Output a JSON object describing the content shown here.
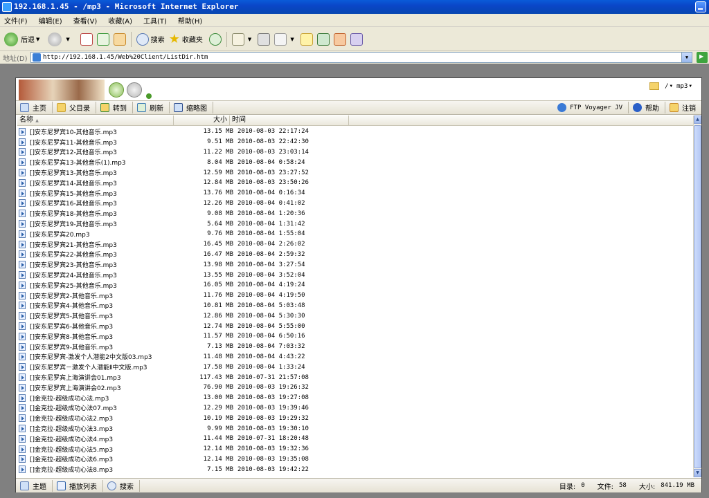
{
  "window": {
    "title": "192.168.1.45 - /mp3 - Microsoft Internet Explorer"
  },
  "menu": [
    "文件(F)",
    "编辑(E)",
    "查看(V)",
    "收藏(A)",
    "工具(T)",
    "帮助(H)"
  ],
  "toolbar": {
    "back_label": "后退",
    "search_label": "搜索",
    "favorites_label": "收藏夹"
  },
  "address": {
    "label": "地址(D)",
    "url": "http://192.168.1.45/Web%20Client/ListDir.htm"
  },
  "path": {
    "root": "/",
    "current": "mp3"
  },
  "nav": {
    "home": "主页",
    "parent": "父目录",
    "goto": "转到",
    "refresh": "刷新",
    "thumbnails": "缩略图",
    "product": "FTP Voyager JV",
    "help": "帮助",
    "logout": "注销"
  },
  "columns": {
    "name": "名称",
    "size": "大小",
    "time": "时间"
  },
  "files": [
    {
      "name": "[]安东尼罗宾10-其他音乐.mp3",
      "size": "13.15 MB",
      "time": "2010-08-03 22:17:24"
    },
    {
      "name": "[]安东尼罗宾11-其他音乐.mp3",
      "size": "9.51 MB",
      "time": "2010-08-03 22:42:30"
    },
    {
      "name": "[]安东尼罗宾12-其他音乐.mp3",
      "size": "11.22 MB",
      "time": "2010-08-03 23:03:14"
    },
    {
      "name": "[]安东尼罗宾13-其他音乐(1).mp3",
      "size": "8.04 MB",
      "time": "2010-08-04 0:58:24"
    },
    {
      "name": "[]安东尼罗宾13-其他音乐.mp3",
      "size": "12.59 MB",
      "time": "2010-08-03 23:27:52"
    },
    {
      "name": "[]安东尼罗宾14-其他音乐.mp3",
      "size": "12.84 MB",
      "time": "2010-08-03 23:50:26"
    },
    {
      "name": "[]安东尼罗宾15-其他音乐.mp3",
      "size": "13.76 MB",
      "time": "2010-08-04 0:16:34"
    },
    {
      "name": "[]安东尼罗宾16-其他音乐.mp3",
      "size": "12.26 MB",
      "time": "2010-08-04 0:41:02"
    },
    {
      "name": "[]安东尼罗宾18-其他音乐.mp3",
      "size": "9.08 MB",
      "time": "2010-08-04 1:20:36"
    },
    {
      "name": "[]安东尼罗宾19-其他音乐.mp3",
      "size": "5.64 MB",
      "time": "2010-08-04 1:31:42"
    },
    {
      "name": "[]安东尼罗宾20.mp3",
      "size": "9.76 MB",
      "time": "2010-08-04 1:55:04"
    },
    {
      "name": "[]安东尼罗宾21-其他音乐.mp3",
      "size": "16.45 MB",
      "time": "2010-08-04 2:26:02"
    },
    {
      "name": "[]安东尼罗宾22-其他音乐.mp3",
      "size": "16.47 MB",
      "time": "2010-08-04 2:59:32"
    },
    {
      "name": "[]安东尼罗宾23-其他音乐.mp3",
      "size": "13.98 MB",
      "time": "2010-08-04 3:27:54"
    },
    {
      "name": "[]安东尼罗宾24-其他音乐.mp3",
      "size": "13.55 MB",
      "time": "2010-08-04 3:52:04"
    },
    {
      "name": "[]安东尼罗宾25-其他音乐.mp3",
      "size": "16.05 MB",
      "time": "2010-08-04 4:19:24"
    },
    {
      "name": "[]安东尼罗宾2-其他音乐.mp3",
      "size": "11.76 MB",
      "time": "2010-08-04 4:19:50"
    },
    {
      "name": "[]安东尼罗宾4-其他音乐.mp3",
      "size": "10.81 MB",
      "time": "2010-08-04 5:03:48"
    },
    {
      "name": "[]安东尼罗宾5-其他音乐.mp3",
      "size": "12.86 MB",
      "time": "2010-08-04 5:30:30"
    },
    {
      "name": "[]安东尼罗宾6-其他音乐.mp3",
      "size": "12.74 MB",
      "time": "2010-08-04 5:55:00"
    },
    {
      "name": "[]安东尼罗宾8-其他音乐.mp3",
      "size": "11.57 MB",
      "time": "2010-08-04 6:50:16"
    },
    {
      "name": "[]安东尼罗宾9-其他音乐.mp3",
      "size": "7.13 MB",
      "time": "2010-08-04 7:03:32"
    },
    {
      "name": "[]安东尼罗宾-激发个人潜能2中文版03.mp3",
      "size": "11.48 MB",
      "time": "2010-08-04 4:43:22"
    },
    {
      "name": "[]安东尼罗宾－激发个人潜能Ⅱ中文版.mp3",
      "size": "17.58 MB",
      "time": "2010-08-04 1:33:24"
    },
    {
      "name": "[]安东尼罗宾上海演讲会01.mp3",
      "size": "117.43 MB",
      "time": "2010-07-31 21:57:08"
    },
    {
      "name": "[]安东尼罗宾上海演讲会02.mp3",
      "size": "76.90 MB",
      "time": "2010-08-03 19:26:32"
    },
    {
      "name": "[]金克拉-超级成功心法.mp3",
      "size": "13.00 MB",
      "time": "2010-08-03 19:27:08"
    },
    {
      "name": "[]金克拉-超级成功心法07.mp3",
      "size": "12.29 MB",
      "time": "2010-08-03 19:39:46"
    },
    {
      "name": "[]金克拉-超级成功心法2.mp3",
      "size": "10.19 MB",
      "time": "2010-08-03 19:29:32"
    },
    {
      "name": "[]金克拉-超级成功心法3.mp3",
      "size": "9.99 MB",
      "time": "2010-08-03 19:30:10"
    },
    {
      "name": "[]金克拉-超级成功心法4.mp3",
      "size": "11.44 MB",
      "time": "2010-07-31 18:20:48"
    },
    {
      "name": "[]金克拉-超级成功心法5.mp3",
      "size": "12.14 MB",
      "time": "2010-08-03 19:32:36"
    },
    {
      "name": "[]金克拉-超级成功心法6.mp3",
      "size": "12.14 MB",
      "time": "2010-08-03 19:35:08"
    },
    {
      "name": "[]金克拉-超级成功心法8.mp3",
      "size": "7.15 MB",
      "time": "2010-08-03 19:42:22"
    }
  ],
  "status": {
    "theme": "主题",
    "playlist": "播放列表",
    "search": "搜索",
    "dirs_label": "目录:",
    "dirs": "0",
    "files_label": "文件:",
    "files": "58",
    "size_label": "大小:",
    "size": "841.19 MB"
  }
}
